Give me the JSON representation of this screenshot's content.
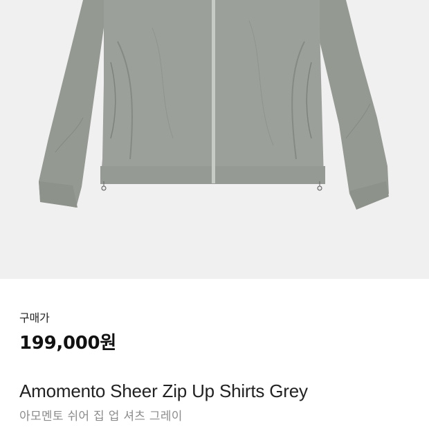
{
  "product": {
    "image_alt": "Grey zip-up shirt jacket",
    "jacket_color": "#9ba09a",
    "image_background": "#f0f0f0",
    "price_label": "구매가",
    "price": "199,000원",
    "name_en": "Amomento Sheer Zip Up Shirts Grey",
    "name_ko": "아모멘토 쉬어 집 업 셔츠 그레이"
  }
}
